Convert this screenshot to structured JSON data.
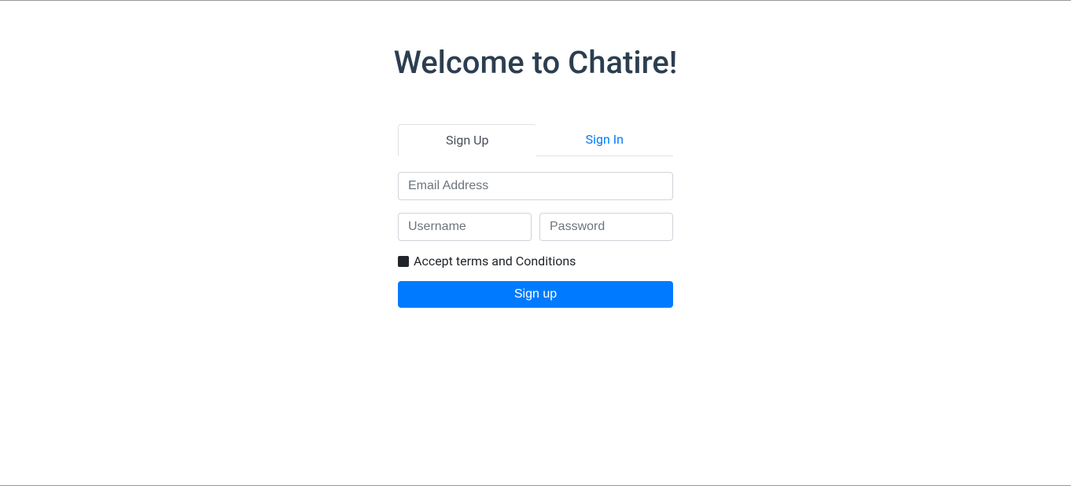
{
  "header": {
    "title": "Welcome to Chatire!"
  },
  "tabs": {
    "signup": "Sign Up",
    "signin": "Sign In"
  },
  "form": {
    "email_placeholder": "Email Address",
    "username_placeholder": "Username",
    "password_placeholder": "Password",
    "terms_label": "Accept terms and Conditions",
    "submit_label": "Sign up"
  }
}
